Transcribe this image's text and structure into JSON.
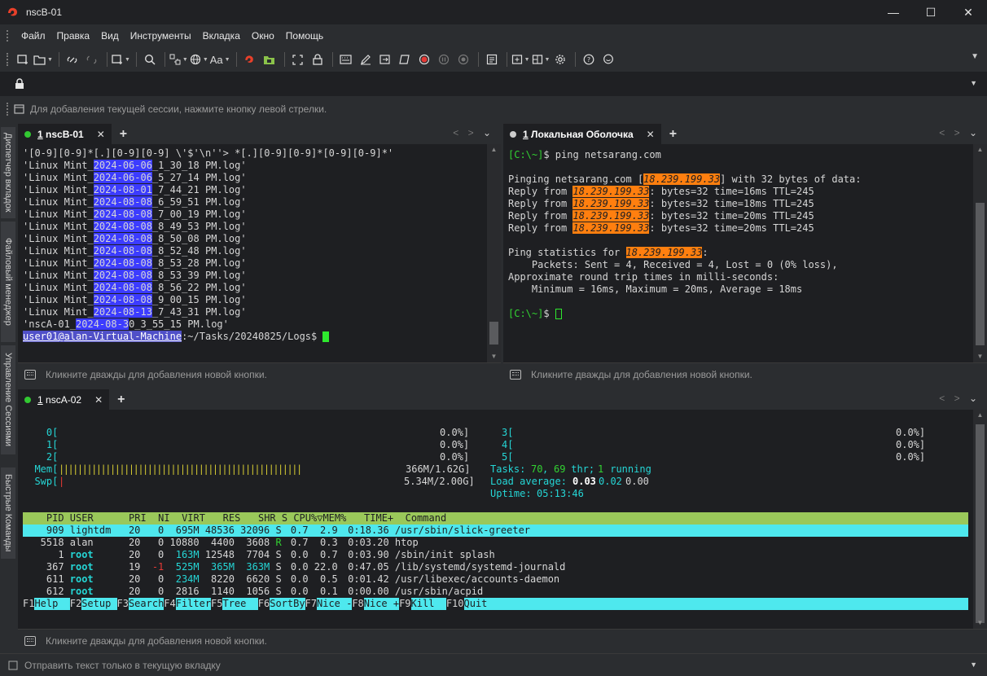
{
  "window": {
    "title": "nscB-01",
    "brand_color": "#e8402a"
  },
  "menu": [
    "Файл",
    "Правка",
    "Вид",
    "Инструменты",
    "Вкладка",
    "Окно",
    "Помощь"
  ],
  "toolbar": {
    "font_label": "Aa"
  },
  "links_bar": {
    "hint": "Для добавления текущей сессии, нажмите кнопку левой стрелки."
  },
  "sidebar": [
    "Диспетчер вкладок",
    "Файловый менеджер",
    "Управление Сессиями",
    "Быстрые Команды"
  ],
  "quick_bar_hint": "Кликните дважды для добавления новой кнопки.",
  "pane1": {
    "tab_num": "1",
    "tab_label": "nscB-01",
    "lines": [
      {
        "pre": "'[0-9][0-9]*[.][0-9][0-9] \\'$'\\n''> *[.][0-9][0-9]*[0-9][0-9]*'",
        "hl": "",
        "post": ""
      },
      {
        "pre": "'Linux Mint_",
        "hl": "2024-06-06",
        "post": "_1_30_18 PM.log'"
      },
      {
        "pre": "'Linux Mint_",
        "hl": "2024-06-06",
        "post": "_5_27_14 PM.log'"
      },
      {
        "pre": "'Linux Mint_",
        "hl": "2024-08-01",
        "post": "_7_44_21 PM.log'"
      },
      {
        "pre": "'Linux Mint_",
        "hl": "2024-08-08",
        "post": "_6_59_51 PM.log'"
      },
      {
        "pre": "'Linux Mint_",
        "hl": "2024-08-08",
        "post": "_7_00_19 PM.log'"
      },
      {
        "pre": "'Linux Mint_",
        "hl": "2024-08-08",
        "post": "_8_49_53 PM.log'"
      },
      {
        "pre": "'Linux Mint_",
        "hl": "2024-08-08",
        "post": "_8_50_08 PM.log'"
      },
      {
        "pre": "'Linux Mint_",
        "hl": "2024-08-08",
        "post": "_8_52_48 PM.log'"
      },
      {
        "pre": "'Linux Mint_",
        "hl": "2024-08-08",
        "post": "_8_53_28 PM.log'"
      },
      {
        "pre": "'Linux Mint_",
        "hl": "2024-08-08",
        "post": "_8_53_39 PM.log'"
      },
      {
        "pre": "'Linux Mint_",
        "hl": "2024-08-08",
        "post": "_8_56_22 PM.log'"
      },
      {
        "pre": "'Linux Mint_",
        "hl": "2024-08-08",
        "post": "_9_00_15 PM.log'"
      },
      {
        "pre": "'Linux Mint_",
        "hl": "2024-08-13",
        "post": "_7_43_31 PM.log'"
      },
      {
        "pre": "'nscA-01_",
        "hl": "2024-08-3",
        "post": "0_3_55_15 PM.log'"
      }
    ],
    "prompt_user": "user01@alan-Virtual-Machine",
    "prompt_path": ":~/Tasks/20240825/Logs$ "
  },
  "pane2": {
    "tab_num": "1",
    "tab_label": "Локальная Оболочка",
    "prompt": "[C:\\~]",
    "cmd": "$ ping netsarang.com",
    "ip": "18.239.199.33",
    "pinging_pre": "Pinging netsarang.com [",
    "pinging_post": "] with 32 bytes of data:",
    "replies": [
      {
        "pre": "Reply from ",
        "post": ": bytes=32 time=16ms TTL=245"
      },
      {
        "pre": "Reply from ",
        "post": ": bytes=32 time=18ms TTL=245"
      },
      {
        "pre": "Reply from ",
        "post": ": bytes=32 time=20ms TTL=245"
      },
      {
        "pre": "Reply from ",
        "post": ": bytes=32 time=20ms TTL=245"
      }
    ],
    "stats_pre": "Ping statistics for ",
    "stats_post": ":",
    "stats": [
      "    Packets: Sent = 4, Received = 4, Lost = 0 (0% loss),",
      "Approximate round trip times in milli-seconds:",
      "    Minimum = 16ms, Maximum = 20ms, Average = 18ms"
    ],
    "prompt2": "[C:\\~]",
    "prompt2_tail": "$ "
  },
  "pane3": {
    "tab_num": "1",
    "tab_label": "nscA-02",
    "cpus_left": [
      {
        "label": "    0[",
        "val": "0.0%]"
      },
      {
        "label": "    1[",
        "val": "0.0%]"
      },
      {
        "label": "    2[",
        "val": "0.0%]"
      }
    ],
    "cpus_right": [
      {
        "label": "3[",
        "val": "0.0%]"
      },
      {
        "label": "4[",
        "val": "0.0%]"
      },
      {
        "label": "5[",
        "val": "0.0%]"
      }
    ],
    "mem_label": "  Mem[",
    "mem_bar": "||||||||||||||||||||||||||||||||||||||||||||||||||||",
    "mem_val": "366M/1.62G]",
    "swp_label": "  Swp[",
    "swp_bar": "|",
    "swp_val": "5.34M/2.00G]",
    "tasks_label": "Tasks: ",
    "tasks_num": "70",
    "tasks_sep": ", ",
    "thr_num": "69",
    "thr_label": " thr; ",
    "running_num": "1",
    "running_label": " running",
    "load_label": "Load average: ",
    "load1": "0.03",
    "load5": "0.02",
    "load15": "0.00",
    "uptime_label": "Uptime: ",
    "uptime": "05:13:46",
    "header": "    PID USER      PRI  NI  VIRT   RES   SHR S CPU%▽MEM%   TIME+  Command",
    "rows": [
      {
        "pid": "    909",
        "user": "lightdm",
        "pri": "20",
        "ni": "0",
        "virt": " 695M",
        "res": "48536",
        "shr": "32096",
        "s": "S",
        "cpu": " 0.7",
        "mem": " 2.9",
        "time": " 0:18.36",
        "cmd": "/usr/sbin/slick-greeter",
        "sel": true
      },
      {
        "pid": "   5518",
        "user": "alan",
        "pri": "20",
        "ni": "0",
        "virt": "10880",
        "res": " 4400",
        "shr": " 3608",
        "s": "R",
        "cpu": " 0.7",
        "mem": " 0.3",
        "time": " 0:03.20",
        "cmd": "htop",
        "sel": false
      },
      {
        "pid": "      1",
        "user": "root",
        "pri": "20",
        "ni": "0",
        "virt": " 163M",
        "res": "12548",
        "shr": " 7704",
        "s": "S",
        "cpu": " 0.0",
        "mem": " 0.7",
        "time": " 0:03.90",
        "cmd": "/sbin/init splash",
        "sel": false
      },
      {
        "pid": "    367",
        "user": "root",
        "pri": "19",
        "ni": "-1",
        "virt": " 525M",
        "res": " 365M",
        "shr": " 363M",
        "s": "S",
        "cpu": " 0.0",
        "mem": "22.0",
        "time": " 0:47.05",
        "cmd": "/lib/systemd/systemd-journald",
        "sel": false
      },
      {
        "pid": "    611",
        "user": "root",
        "pri": "20",
        "ni": "0",
        "virt": " 234M",
        "res": " 8220",
        "shr": " 6620",
        "s": "S",
        "cpu": " 0.0",
        "mem": " 0.5",
        "time": " 0:01.42",
        "cmd": "/usr/libexec/accounts-daemon",
        "sel": false
      },
      {
        "pid": "    612",
        "user": "root",
        "pri": "20",
        "ni": "0",
        "virt": " 2816",
        "res": " 1140",
        "shr": " 1056",
        "s": "S",
        "cpu": " 0.0",
        "mem": " 0.1",
        "time": " 0:00.00",
        "cmd": "/usr/sbin/acpid",
        "sel": false
      }
    ],
    "fkeys": [
      {
        "k": "F1",
        "l": "Help  "
      },
      {
        "k": "F2",
        "l": "Setup "
      },
      {
        "k": "F3",
        "l": "Search"
      },
      {
        "k": "F4",
        "l": "Filter"
      },
      {
        "k": "F5",
        "l": "Tree  "
      },
      {
        "k": "F6",
        "l": "SortBy"
      },
      {
        "k": "F7",
        "l": "Nice -"
      },
      {
        "k": "F8",
        "l": "Nice +"
      },
      {
        "k": "F9",
        "l": "Kill  "
      },
      {
        "k": "F10",
        "l": "Quit"
      }
    ]
  },
  "status_bar": {
    "hint": "Отправить текст только в текущую вкладку"
  }
}
